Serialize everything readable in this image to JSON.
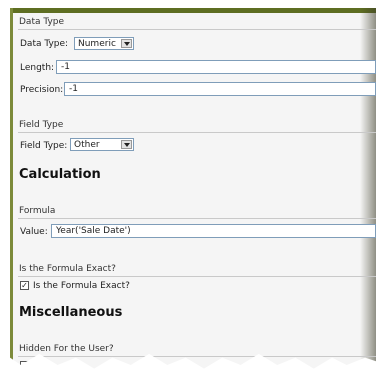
{
  "data_type": {
    "section": "Data Type",
    "data_type_label": "Data Type:",
    "data_type_value": "Numeric",
    "length_label": "Length:",
    "length_value": "-1",
    "precision_label": "Precision:",
    "precision_value": "-1"
  },
  "field_type": {
    "section": "Field Type",
    "field_type_label": "Field Type:",
    "field_type_value": "Other"
  },
  "calculation": {
    "heading": "Calculation",
    "formula_section": "Formula",
    "value_label": "Value:",
    "value_text": "Year('Sale Date')",
    "exact_section": "Is the Formula Exact?",
    "exact_checkbox_label": "Is the Formula Exact?",
    "exact_checked": "✓"
  },
  "miscellaneous": {
    "heading": "Miscellaneous",
    "hidden_section": "Hidden For the User?"
  },
  "colors": {
    "frame": "#5e6e22",
    "panel": "#f5f5f5",
    "input_border": "#7f9db9"
  },
  "icons": [
    "chevron-down-icon",
    "checkmark-icon"
  ]
}
